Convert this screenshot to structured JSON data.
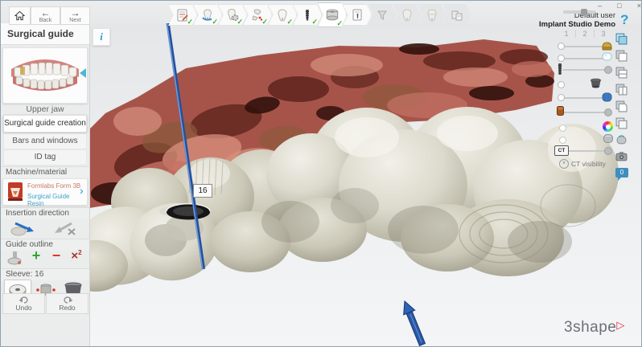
{
  "window": {
    "minimize": "–",
    "maximize": "□",
    "close": "×"
  },
  "nav": {
    "back": "Back",
    "next": "Next"
  },
  "info_button": {
    "glyph": "i"
  },
  "toolbar": {
    "checkmark": "✓",
    "steps": [
      {
        "icon": "order-form-icon",
        "done": true
      },
      {
        "icon": "scan-align-icon",
        "done": true
      },
      {
        "icon": "segmentation-icon",
        "done": true
      },
      {
        "icon": "annotation-icon",
        "done": true
      },
      {
        "icon": "crown-setup-icon",
        "done": true
      },
      {
        "icon": "implant-planning-icon",
        "done": true
      },
      {
        "icon": "sleeve-design-icon",
        "done": true,
        "active": true
      },
      {
        "icon": "report-icon",
        "done": false
      },
      {
        "icon": "funnel-icon",
        "done": false,
        "disabled": true
      },
      {
        "icon": "crown-design-icon",
        "done": false,
        "disabled": true
      },
      {
        "icon": "bridge-design-icon",
        "done": false,
        "disabled": true
      },
      {
        "icon": "export-layout-icon",
        "done": false,
        "disabled": true
      }
    ]
  },
  "sidebar": {
    "title": "Surgical guide",
    "jaw_label": "Upper jaw",
    "menu": [
      "Surgical guide creation",
      "Bars and windows",
      "ID tag"
    ],
    "machine": {
      "header": "Machine/material",
      "name": "Formlabs Form 3B",
      "material": "Surgical Guide Resin",
      "chevron": "›"
    },
    "insertion": {
      "header": "Insertion direction"
    },
    "guide_outline": {
      "header": "Guide outline",
      "plus": "+",
      "minus": "−",
      "clear": "×",
      "clear_sup": "2"
    },
    "sleeve": {
      "header": "Sleeve: 16"
    },
    "history": {
      "undo": "Undo",
      "redo": "Redo"
    }
  },
  "user": {
    "name": "Default user",
    "product": "Implant Studio Demo",
    "help": "?"
  },
  "right_panel": {
    "presets": [
      "1",
      "2",
      "3"
    ],
    "ct_knob": "CT",
    "ct_chevron": "∨",
    "ct_visibility": "CT visibility",
    "comments": "0"
  },
  "scene": {
    "tooth_label": "16"
  },
  "logo": {
    "text": "3shape",
    "mark": "▷"
  },
  "colors": {
    "accent_blue": "#2f63b8",
    "check_green": "#3fae29",
    "tissue": "#a6544a",
    "guide_ivory": "#d8d5c6",
    "machine_name": "#c97a64",
    "material_cyan": "#3fa3c8",
    "help_blue": "#2d9fd6"
  }
}
